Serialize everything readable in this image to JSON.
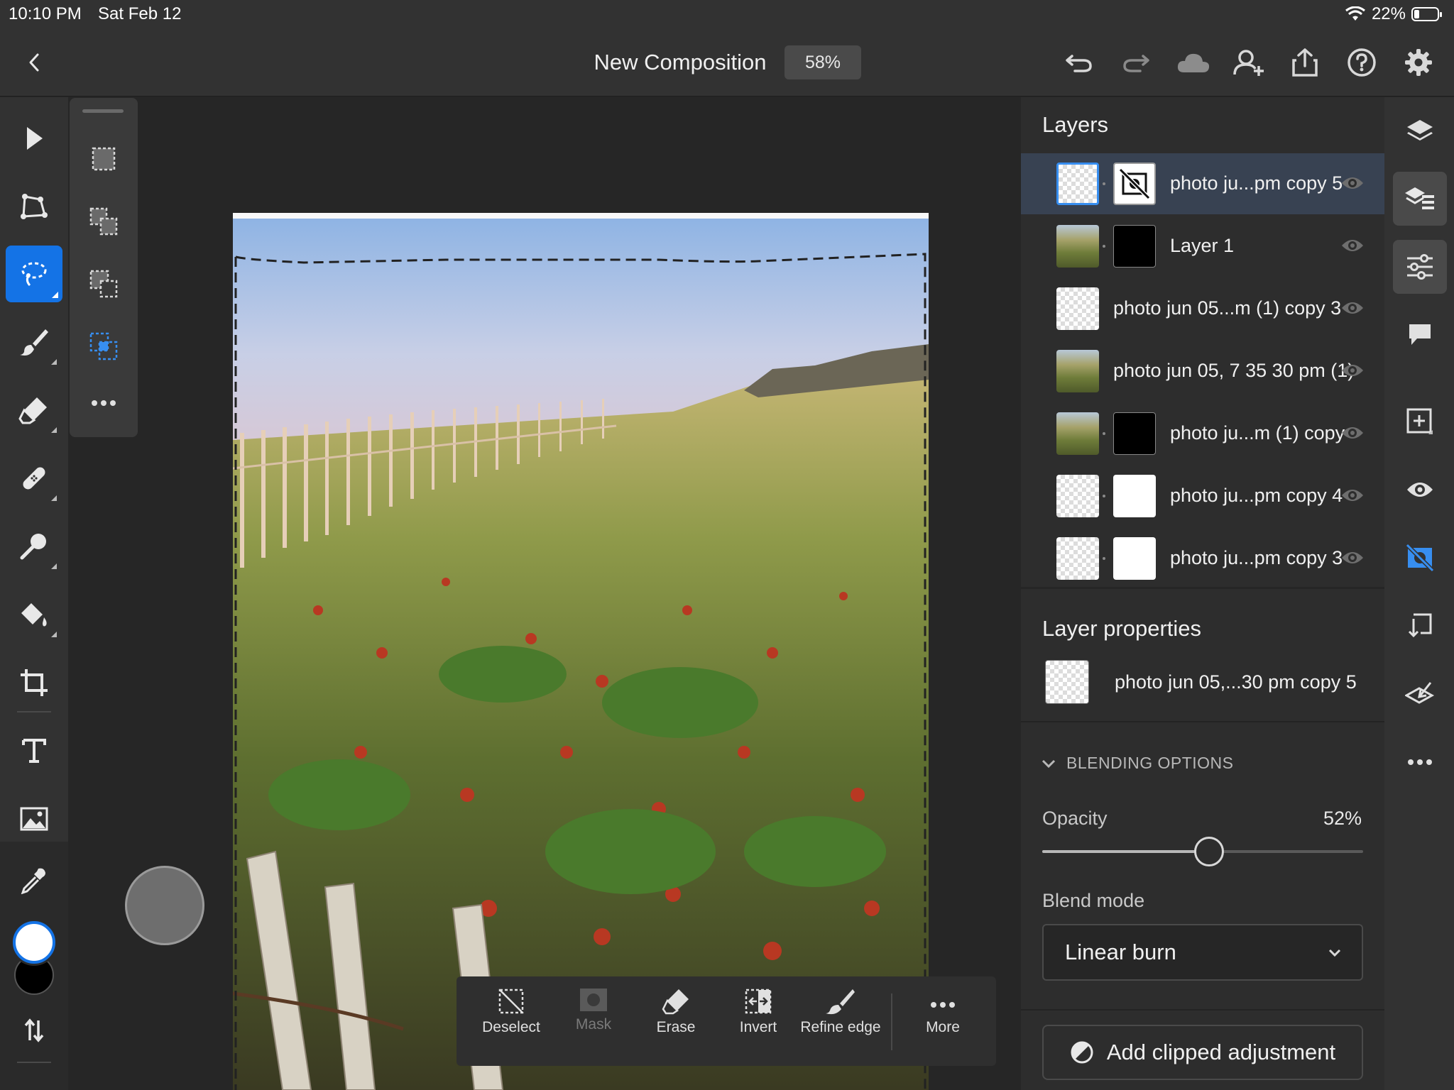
{
  "status": {
    "time": "10:10 PM",
    "date": "Sat Feb 12",
    "battery": "22%"
  },
  "header": {
    "title": "New Composition",
    "zoom": "58%"
  },
  "layers": {
    "title": "Layers",
    "items": [
      {
        "name": "photo ju...pm copy 5",
        "thumb": "checker",
        "mask": "hidden-mask",
        "selected": true
      },
      {
        "name": "Layer 1",
        "thumb": "photo",
        "mask": "black",
        "selected": false
      },
      {
        "name": "photo jun 05...m (1) copy 3",
        "thumb": "checker",
        "mask": null,
        "selected": false
      },
      {
        "name": "photo jun 05, 7 35 30 pm (1)",
        "thumb": "photo",
        "mask": null,
        "selected": false
      },
      {
        "name": "photo ju...m (1) copy",
        "thumb": "photo",
        "mask": "black",
        "selected": false
      },
      {
        "name": "photo ju...pm copy 4",
        "thumb": "checker",
        "mask": "white",
        "selected": false
      },
      {
        "name": "photo ju...pm copy 3",
        "thumb": "checker",
        "mask": "white",
        "selected": false
      }
    ]
  },
  "props": {
    "title": "Layer properties",
    "layer_name": "photo jun 05,...30 pm copy 5",
    "blending_label": "BLENDING OPTIONS",
    "opacity_label": "Opacity",
    "opacity_value": "52%",
    "opacity": 0.52,
    "blend_label": "Blend mode",
    "blend_value": "Linear burn",
    "adjust_label": "Add clipped adjustment"
  },
  "actions": [
    {
      "label": "Deselect",
      "icon": "deselect-icon",
      "enabled": true
    },
    {
      "label": "Mask",
      "icon": "mask-icon",
      "enabled": false
    },
    {
      "label": "Erase",
      "icon": "eraser-icon",
      "enabled": true
    },
    {
      "label": "Invert",
      "icon": "invert-icon",
      "enabled": true
    },
    {
      "label": "Refine edge",
      "icon": "refine-edge-icon",
      "enabled": true
    },
    {
      "label": "More",
      "icon": "more-icon",
      "enabled": true
    }
  ],
  "colors": {
    "accent": "#1473e6",
    "panel": "#2d2d2d",
    "selected_row": "#384252"
  }
}
